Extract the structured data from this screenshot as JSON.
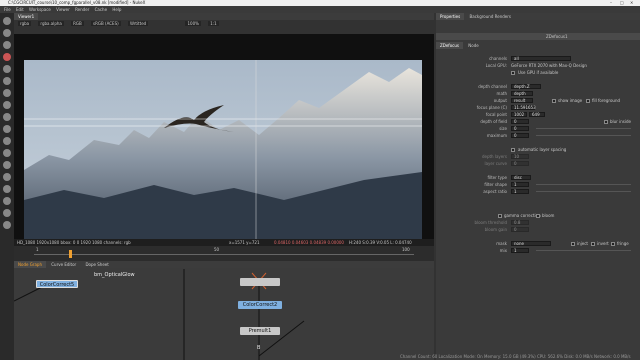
{
  "window": {
    "title": "C:\\CGCIRCUIT_course\\10_comp_fgparallel_v08.nk [modified] - NukeX"
  },
  "menu": [
    "File",
    "Edit",
    "Workspace",
    "Viewer",
    "Render",
    "Cache",
    "Help"
  ],
  "viewer": {
    "tab": "Viewer1",
    "channels": "rgba",
    "alpha": "rgba.alpha",
    "colorspace": "RGB",
    "view": "sRGB (ACES)",
    "mode": "Wrtitted",
    "zoom": "100%",
    "ratio": "1:1",
    "res": "HD_1080 1920x1080  bbox: 0 0 1920 1080 channels: rgb",
    "coords": "x=1571 y=721",
    "pixel": "0.04810  0.04603  0.04839  0.00000",
    "hsv": "H:240 S:0.39 V:0.05  L: 0.04740"
  },
  "timeline": {
    "frame": "17",
    "fps": "24*",
    "tc": "TF",
    "scope": "Global",
    "start": "1",
    "end": "100",
    "marks": [
      "1",
      "50",
      "100"
    ]
  },
  "nodegraph": {
    "tabs": [
      "Node Graph",
      "Curve Editor",
      "Dope Sheet"
    ],
    "nodes": {
      "cc5": "ColorCorrect5",
      "og": "bm_OpticalGlow",
      "cc2": "ColorCorrect2",
      "pre": "Premult1",
      "b": "B"
    }
  },
  "properties": {
    "tabs": [
      "Properties",
      "Background Renders"
    ],
    "node_title": "ZDefocus1",
    "subtabs": [
      "ZDefocus",
      "Node"
    ],
    "rows": {
      "channels_label": "channels",
      "channels_val": "all",
      "gpu_label": "Local GPU:",
      "gpu_val": "GeForce RTX 2070 with Max-Q Design",
      "usegpu": "Use GPU if available",
      "depth_label": "depth channel",
      "depth_val": "depth.Z",
      "math_label": "math",
      "math_val": "depth",
      "output_label": "output",
      "output_val": "result",
      "showimage": "show image",
      "fillfg": "fill foreground",
      "focal_label": "focus plane (C)",
      "focal_val": "11.591653",
      "fpoint_label": "focal point",
      "fpoint_x": "1002",
      "fpoint_y": "649",
      "dof_label": "depth of field",
      "dof_val": "0",
      "blurinside": "blur inside",
      "size_label": "size",
      "size_val": "0",
      "max_label": "maximum",
      "max_val": "0",
      "autolayer": "automatic layer spacing",
      "layers_label": "depth layers",
      "layers_val": "10",
      "curve_label": "layer curve",
      "curve_val": "0",
      "ftype_label": "filter type",
      "ftype_val": "disc",
      "fshape_label": "filter shape",
      "fshape_val": "1",
      "aspect_label": "aspect ratio",
      "aspect_val": "1",
      "gamma": "gamma correction",
      "bloom": "bloom",
      "bthresh_label": "bloom threshold",
      "bthresh_val": "0.8",
      "bgain_label": "bloom gain",
      "bgain_val": "0",
      "mask_label": "mask",
      "mask_val": "none",
      "inject": "inject",
      "invert": "invert",
      "fringe": "fringe",
      "mix_label": "mix",
      "mix_val": "1"
    }
  },
  "status": "Channel Count: 60  Localization Mode: On  Memory: 15.0 GB (49.3%)  CPU: 562.6%  Disk: 0.0 MB/s  Network: 0.0 MB/s",
  "colors": {
    "cc": "#7fb0e0",
    "premult": "#c8c8c8",
    "focus": "#d06030"
  }
}
